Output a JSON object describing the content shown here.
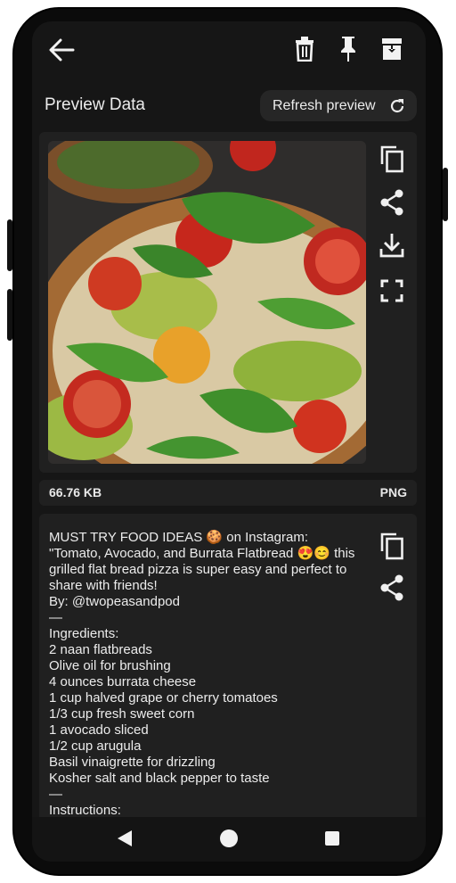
{
  "toolbar": {
    "back_icon": "arrow-left-icon",
    "delete_icon": "trash-icon",
    "pin_icon": "pin-icon",
    "archive_icon": "archive-download-icon"
  },
  "header": {
    "title": "Preview Data",
    "refresh_label": "Refresh preview",
    "refresh_icon": "refresh-icon"
  },
  "image_actions": [
    "copy-icon",
    "share-icon",
    "download-icon",
    "fullscreen-icon"
  ],
  "file_info": {
    "size": "66.76 KB",
    "format": "PNG"
  },
  "description": {
    "text": "MUST TRY FOOD IDEAS 🍪 on Instagram: \"Tomato, Avocado, and Burrata Flatbread 😍😊 this grilled flat bread pizza is super easy and perfect to share with friends!\nBy: @twopeasandpod\n—\nIngredients:\n2 naan flatbreads\nOlive oil for brushing\n4 ounces burrata cheese\n1 cup halved grape or cherry tomatoes\n1/3 cup fresh sweet corn\n1 avocado sliced\n1/2 cup arugula\nBasil vinaigrette for drizzling\nKosher salt and black pepper to taste\n—\nInstructions:",
    "actions": [
      "copy-icon",
      "share-icon"
    ]
  },
  "navbar": [
    "back-triangle-icon",
    "home-circle-icon",
    "recents-square-icon"
  ],
  "colors": {
    "background": "#161616",
    "card": "#202020",
    "text": "#ececec"
  }
}
